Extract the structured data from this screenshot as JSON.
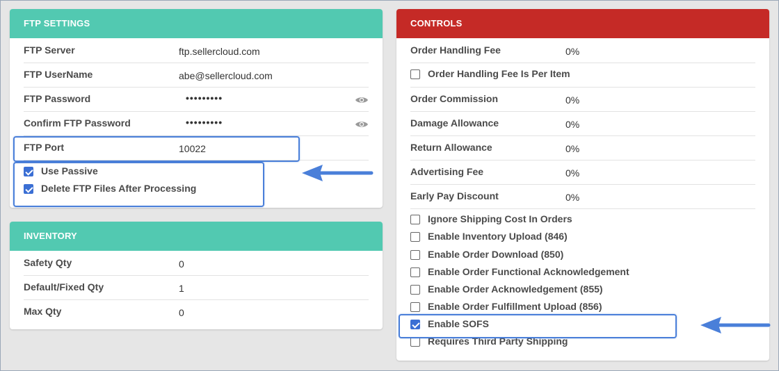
{
  "ftp": {
    "title": "FTP SETTINGS",
    "server_label": "FTP Server",
    "server_value": "ftp.sellercloud.com",
    "username_label": "FTP UserName",
    "username_value": "abe@sellercloud.com",
    "password_label": "FTP Password",
    "password_value": "•••••••••",
    "confirm_label": "Confirm FTP Password",
    "confirm_value": "•••••••••",
    "port_label": "FTP Port",
    "port_value": "10022",
    "passive_label": "Use Passive",
    "delete_label": "Delete FTP Files After Processing"
  },
  "inventory": {
    "title": "INVENTORY",
    "safety_label": "Safety Qty",
    "safety_value": "0",
    "default_label": "Default/Fixed Qty",
    "default_value": "1",
    "max_label": "Max Qty",
    "max_value": "0"
  },
  "controls": {
    "title": "CONTROLS",
    "handling_fee_label": "Order Handling Fee",
    "handling_fee_value": "0%",
    "handling_per_item_label": "Order Handling Fee Is Per Item",
    "commission_label": "Order Commission",
    "commission_value": "0%",
    "damage_label": "Damage Allowance",
    "damage_value": "0%",
    "return_label": "Return Allowance",
    "return_value": "0%",
    "advertising_label": "Advertising Fee",
    "advertising_value": "0%",
    "early_pay_label": "Early Pay Discount",
    "early_pay_value": "0%",
    "ignore_shipping_label": "Ignore Shipping Cost In Orders",
    "inventory_upload_label": "Enable Inventory Upload (846)",
    "order_download_label": "Enable Order Download (850)",
    "functional_ack_label": "Enable Order Functional Acknowledgement",
    "order_ack_label": "Enable Order Acknowledgement (855)",
    "fulfillment_label": "Enable Order Fulfillment Upload (856)",
    "sofs_label": "Enable SOFS",
    "third_party_label": "Requires Third Party Shipping"
  },
  "checkbox_states": {
    "use_passive": true,
    "delete_ftp_files": true,
    "handling_per_item": false,
    "ignore_shipping": false,
    "inventory_upload": false,
    "order_download": false,
    "functional_ack": false,
    "order_ack": false,
    "fulfillment": false,
    "sofs": true,
    "third_party": false
  },
  "colors": {
    "teal_header": "#52c9b1",
    "red_header": "#c52a26",
    "checkbox_checked": "#3b6fd4",
    "annotation_blue": "#4a7fd9"
  },
  "icons": {
    "show_password": "eye-icon",
    "annotation": "arrow-left-icon"
  }
}
